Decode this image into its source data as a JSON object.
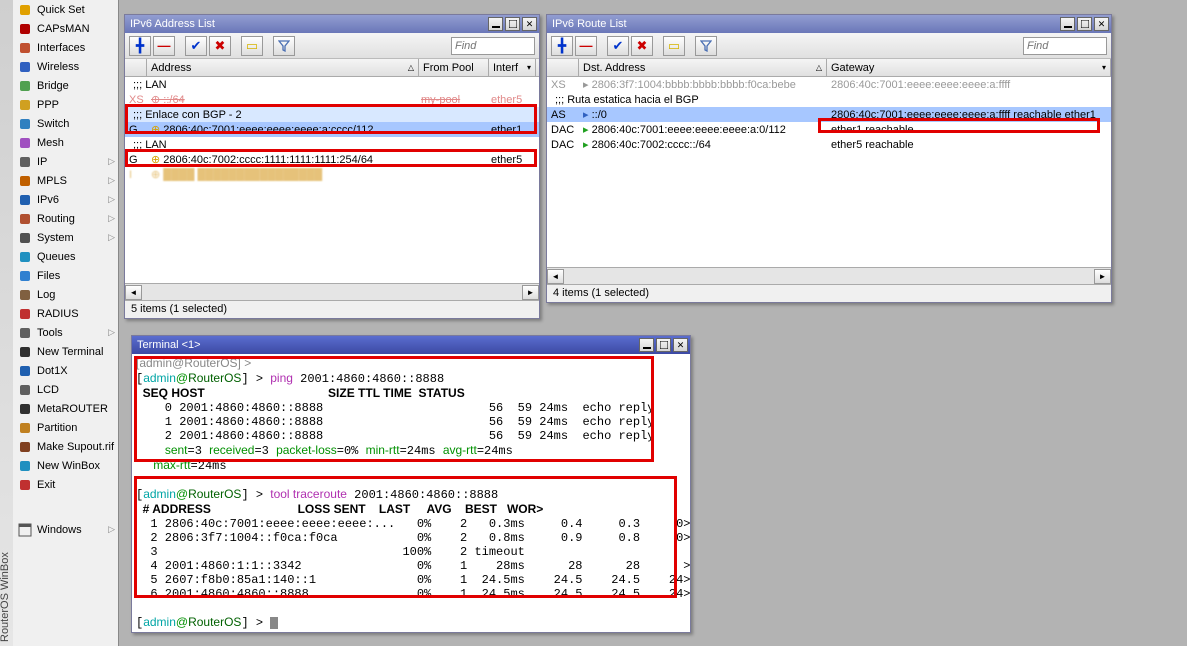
{
  "sidebar": {
    "vtitle": "RouterOS WinBox",
    "items": [
      {
        "label": "Quick Set"
      },
      {
        "label": "CAPsMAN"
      },
      {
        "label": "Interfaces"
      },
      {
        "label": "Wireless"
      },
      {
        "label": "Bridge"
      },
      {
        "label": "PPP"
      },
      {
        "label": "Switch"
      },
      {
        "label": "Mesh"
      },
      {
        "label": "IP",
        "sub": true
      },
      {
        "label": "MPLS",
        "sub": true
      },
      {
        "label": "IPv6",
        "sub": true
      },
      {
        "label": "Routing",
        "sub": true
      },
      {
        "label": "System",
        "sub": true
      },
      {
        "label": "Queues"
      },
      {
        "label": "Files"
      },
      {
        "label": "Log"
      },
      {
        "label": "RADIUS"
      },
      {
        "label": "Tools",
        "sub": true
      },
      {
        "label": "New Terminal"
      },
      {
        "label": "Dot1X"
      },
      {
        "label": "LCD"
      },
      {
        "label": "MetaROUTER"
      },
      {
        "label": "Partition"
      },
      {
        "label": "Make Supout.rif"
      },
      {
        "label": "New WinBox"
      },
      {
        "label": "Exit"
      }
    ],
    "windows_label": "Windows"
  },
  "addr_win": {
    "title": "IPv6 Address List",
    "find": "Find",
    "headers": {
      "c1": "",
      "c2": "Address",
      "c3": "From Pool",
      "c4": "Interf"
    },
    "rows": [
      {
        "type": "comment",
        "text": ";;; LAN"
      },
      {
        "type": "strike",
        "flag": "XS",
        "addr": "::/64",
        "pool": "my-pool",
        "intf": "ether5"
      },
      {
        "type": "comment",
        "text": ";;; Enlace con BGP - 2",
        "hl": "light"
      },
      {
        "type": "data",
        "flag": "G",
        "addr": "2806:40c:7001:eeee:eeee:eeee:a:cccc/112",
        "pool": "",
        "intf": "ether1",
        "selected": true
      },
      {
        "type": "comment",
        "text": ";;; LAN"
      },
      {
        "type": "data",
        "flag": "G",
        "addr": "2806:40c:7002:cccc:1111:1111:1111:254/64",
        "pool": "",
        "intf": "ether5"
      },
      {
        "type": "invalid",
        "flag": "I"
      }
    ],
    "status": "5 items (1 selected)"
  },
  "route_win": {
    "title": "IPv6 Route List",
    "find": "Find",
    "headers": {
      "c1": "",
      "c2": "Dst. Address",
      "c3": "Gateway"
    },
    "rows": [
      {
        "flag": "XS",
        "dst": "2806:3f7:1004:bbbb:bbbb:bbbb:f0ca:bebe",
        "gw": "2806:40c:7001:eeee:eeee:eeee:a:ffff",
        "gray": true
      },
      {
        "type": "comment",
        "text": ";;; Ruta estatica hacia el BGP"
      },
      {
        "flag": "AS",
        "dst": "::/0",
        "gw": "2806:40c:7001:eeee:eeee:eeee:a:ffff reachable ether1",
        "selected": true
      },
      {
        "flag": "DAC",
        "dst": "2806:40c:7001:eeee:eeee:eeee:a:0/112",
        "gw": "ether1 reachable"
      },
      {
        "flag": "DAC",
        "dst": "2806:40c:7002:cccc::/64",
        "gw": "ether5 reachable"
      }
    ],
    "status": "4 items (1 selected)"
  },
  "term": {
    "title": "Terminal <1>",
    "line0": "[admin@RouterOS] >",
    "prompt_user": "admin",
    "prompt_at": "@",
    "prompt_host": "RouterOS",
    "ping_cmd": "ping",
    "ping_target": "2001:4860:4860::8888",
    "ping_header": "  SEQ HOST                                     SIZE TTL TIME  STATUS",
    "ping_rows": [
      "    0 2001:4860:4860::8888                       56  59 24ms  echo reply",
      "    1 2001:4860:4860::8888                       56  59 24ms  echo reply",
      "    2 2001:4860:4860::8888                       56  59 24ms  echo reply"
    ],
    "ping_summary_parts": {
      "sent": "sent",
      "sent_v": "=3 ",
      "recv": "received",
      "recv_v": "=3 ",
      "pl": "packet-loss",
      "pl_v": "=0% ",
      "min": "min-rtt",
      "min_v": "=24ms ",
      "avg": "avg-rtt",
      "avg_v": "=24ms",
      "max": "   max-rtt",
      "max_v": "=24ms"
    },
    "tr_cmd": "tool traceroute",
    "tr_target": "2001:4860:4860::8888",
    "tr_header": "  # ADDRESS                          LOSS SENT    LAST     AVG    BEST   WOR>",
    "tr_rows": [
      "  1 2806:40c:7001:eeee:eeee:eeee:...   0%    2   0.3ms     0.4     0.3     0>",
      "  2 2806:3f7:1004::f0ca:f0ca           0%    2   0.8ms     0.9     0.8     0>",
      "  3                                  100%    2 timeout",
      "  4 2001:4860:1:1::3342                0%    1    28ms      28      28      >",
      "  5 2607:f8b0:85a1:140::1              0%    1  24.5ms    24.5    24.5    24>",
      "  6 2001:4860:4860::8888               0%    1  24.5ms    24.5    24.5    24>"
    ]
  }
}
